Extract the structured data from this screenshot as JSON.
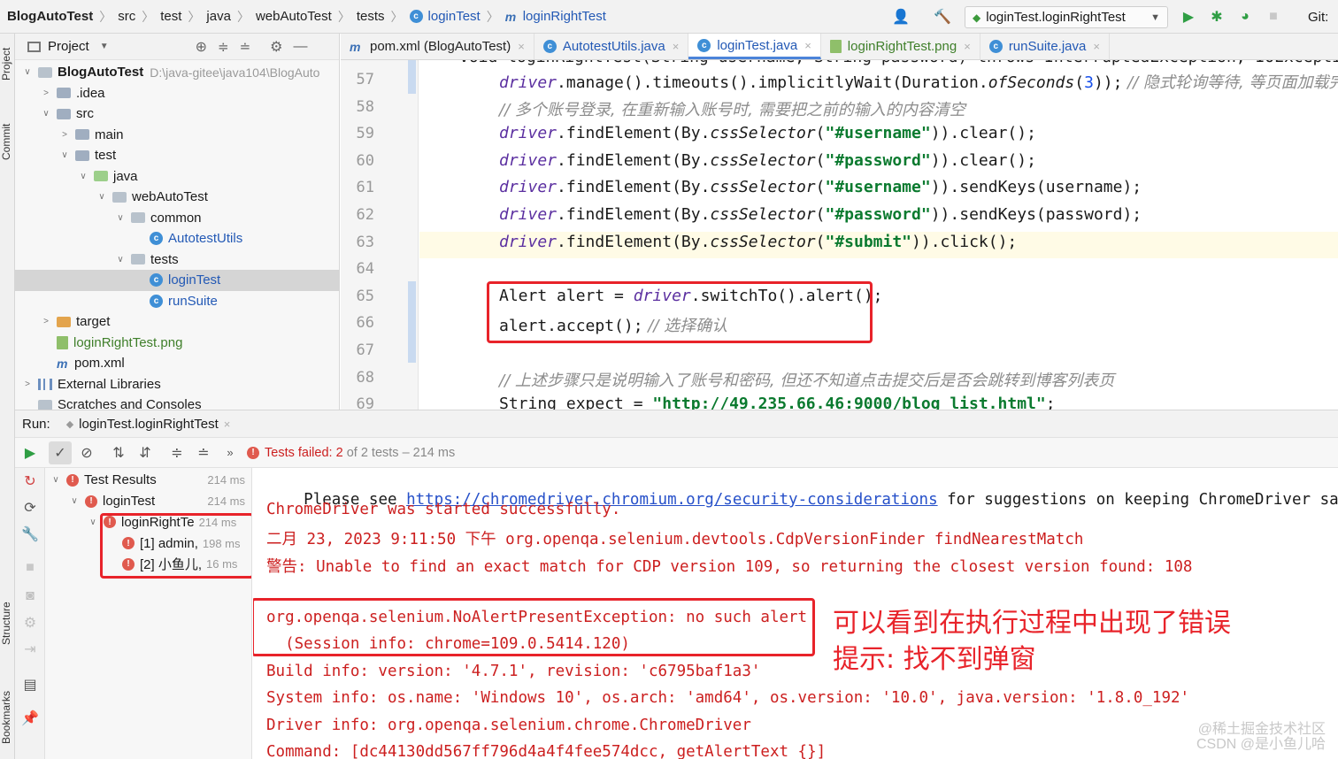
{
  "breadcrumbs": [
    "BlogAutoTest",
    "src",
    "test",
    "java",
    "webAutoTest",
    "tests",
    "loginTest",
    "loginRightTest"
  ],
  "run_config": "loginTest.loginRightTest",
  "vcs_label": "Git:",
  "left_strip": {
    "project": "Project",
    "commit": "Commit",
    "structure": "Structure",
    "bookmarks": "Bookmarks"
  },
  "project_panel": {
    "title": "Project",
    "tree": [
      {
        "label": "BlogAutoTest",
        "path": "D:\\java-gitee\\java104\\BlogAuto",
        "indent": 0,
        "expanded": true,
        "type": "root"
      },
      {
        "label": ".idea",
        "indent": 1,
        "expanded": false,
        "type": "folder"
      },
      {
        "label": "src",
        "indent": 1,
        "expanded": true,
        "type": "folder"
      },
      {
        "label": "main",
        "indent": 2,
        "expanded": false,
        "type": "folder"
      },
      {
        "label": "test",
        "indent": 2,
        "expanded": true,
        "type": "folder"
      },
      {
        "label": "java",
        "indent": 3,
        "expanded": true,
        "type": "test"
      },
      {
        "label": "webAutoTest",
        "indent": 4,
        "expanded": true,
        "type": "pkg"
      },
      {
        "label": "common",
        "indent": 5,
        "expanded": true,
        "type": "pkg"
      },
      {
        "label": "AutotestUtils",
        "indent": 6,
        "type": "class"
      },
      {
        "label": "tests",
        "indent": 5,
        "expanded": true,
        "type": "pkg"
      },
      {
        "label": "loginTest",
        "indent": 6,
        "type": "class",
        "selected": true
      },
      {
        "label": "runSuite",
        "indent": 6,
        "type": "class"
      },
      {
        "label": "target",
        "indent": 1,
        "expanded": false,
        "type": "target"
      },
      {
        "label": "loginRightTest.png",
        "indent": 1,
        "type": "png"
      },
      {
        "label": "pom.xml",
        "indent": 1,
        "type": "maven"
      },
      {
        "label": "External Libraries",
        "indent": 0,
        "expanded": false,
        "type": "lib"
      },
      {
        "label": "Scratches and Consoles",
        "indent": 0,
        "type": "scratch"
      }
    ]
  },
  "editor_tabs": [
    {
      "label": "pom.xml (BlogAutoTest)",
      "icon": "maven-icon",
      "active": false
    },
    {
      "label": "AutotestUtils.java",
      "icon": "class-icon",
      "active": false
    },
    {
      "label": "loginTest.java",
      "icon": "class-icon",
      "active": true
    },
    {
      "label": "loginRightTest.png",
      "icon": "image-icon",
      "active": false
    },
    {
      "label": "runSuite.java",
      "icon": "class-icon",
      "active": false
    }
  ],
  "code_lines": [
    {
      "n": "57",
      "segs": [
        [
          "drv",
          "driver"
        ],
        [
          "",
          ".manage().timeouts().implicitlyWait(Duration."
        ],
        [
          "st",
          "ofSeconds"
        ],
        [
          "",
          "("
        ],
        [
          "num",
          "3"
        ],
        [
          "",
          "));"
        ],
        [
          "cmt",
          " // 隐式轮询等待, 等页面加载完成"
        ]
      ]
    },
    {
      "n": "58",
      "segs": [
        [
          "cmt",
          "// 多个账号登录, 在重新输入账号时, 需要把之前的输入的内容清空"
        ]
      ]
    },
    {
      "n": "59",
      "segs": [
        [
          "drv",
          "driver"
        ],
        [
          "",
          ".findElement(By."
        ],
        [
          "st",
          "cssSelector"
        ],
        [
          "",
          "("
        ],
        [
          "str",
          "\"#username\""
        ],
        [
          "",
          "))"
        ],
        [
          "",
          ".clear();"
        ]
      ]
    },
    {
      "n": "60",
      "segs": [
        [
          "drv",
          "driver"
        ],
        [
          "",
          ".findElement(By."
        ],
        [
          "st",
          "cssSelector"
        ],
        [
          "",
          "("
        ],
        [
          "str",
          "\"#password\""
        ],
        [
          "",
          "))"
        ],
        [
          "",
          ".clear();"
        ]
      ]
    },
    {
      "n": "61",
      "segs": [
        [
          "drv",
          "driver"
        ],
        [
          "",
          ".findElement(By."
        ],
        [
          "st",
          "cssSelector"
        ],
        [
          "",
          "("
        ],
        [
          "str",
          "\"#username\""
        ],
        [
          "",
          "))"
        ],
        [
          "",
          ".sendKeys(username);"
        ]
      ]
    },
    {
      "n": "62",
      "segs": [
        [
          "drv",
          "driver"
        ],
        [
          "",
          ".findElement(By."
        ],
        [
          "st",
          "cssSelector"
        ],
        [
          "",
          "("
        ],
        [
          "str",
          "\"#password\""
        ],
        [
          "",
          "))"
        ],
        [
          "",
          ".sendKeys(password);"
        ]
      ]
    },
    {
      "n": "63",
      "segs": [
        [
          "drv",
          "driver"
        ],
        [
          "",
          ".findElement(By."
        ],
        [
          "st",
          "cssSelector"
        ],
        [
          "",
          "("
        ],
        [
          "str",
          "\"#submit\""
        ],
        [
          "",
          "))"
        ],
        [
          "",
          ".click();"
        ]
      ]
    },
    {
      "n": "64",
      "segs": []
    },
    {
      "n": "65",
      "segs": [
        [
          "",
          "Alert alert = "
        ],
        [
          "drv",
          "driver"
        ],
        [
          "",
          ".switchTo().alert();"
        ]
      ]
    },
    {
      "n": "66",
      "segs": [
        [
          "",
          "alert.accept();"
        ],
        [
          "cmt",
          " // 选择确认"
        ]
      ]
    },
    {
      "n": "67",
      "segs": []
    },
    {
      "n": "68",
      "segs": [
        [
          "cmt",
          "// 上述步骤只是说明输入了账号和密码, 但还不知道点击提交后是否会跳转到博客列表页"
        ]
      ]
    },
    {
      "n": "69",
      "segs": [
        [
          "",
          "String expect = "
        ],
        [
          "str",
          "\"http://49.235.66.46:9000/blog_list.html\""
        ],
        [
          "",
          ";"
        ]
      ]
    }
  ],
  "run_panel": {
    "label": "Run:",
    "config_tab": "loginTest.loginRightTest",
    "status_failed": "Tests failed: 2",
    "status_rest": " of 2 tests – 214 ms",
    "results": [
      {
        "label": "Test Results",
        "dur": "214 ms",
        "indent": 0
      },
      {
        "label": "loginTest",
        "dur": "214 ms",
        "indent": 1
      },
      {
        "label": "loginRightTe",
        "dur": "214 ms",
        "indent": 2
      },
      {
        "label": "[1] admin,",
        "dur": "198 ms",
        "indent": 3
      },
      {
        "label": "[2] 小鱼儿,",
        "dur": "16 ms",
        "indent": 3
      }
    ]
  },
  "console": {
    "line1_pre": "Please see ",
    "line1_link": "https://chromedriver.chromium.org/security-considerations",
    "line1_post": " for suggestions on keeping ChromeDriver safe.",
    "line2": "ChromeDriver was started successfully.",
    "line3": "二月 23, 2023 9:11:50 下午 org.openqa.selenium.devtools.CdpVersionFinder findNearestMatch",
    "line4": "警告: Unable to find an exact match for CDP version 109, so returning the closest version found: 108",
    "line5": "org.openqa.selenium.NoAlertPresentException: no such alert",
    "line6": "  (Session info: chrome=109.0.5414.120)",
    "line7": "Build info: version: '4.7.1', revision: 'c6795baf1a3'",
    "line8": "System info: os.name: 'Windows 10', os.arch: 'amd64', os.version: '10.0', java.version: '1.8.0_192'",
    "line9": "Driver info: org.openqa.selenium.chrome.ChromeDriver",
    "line10": "Command: [dc44130dd567ff796d4a4f4fee574dcc, getAlertText {}]"
  },
  "annotation": {
    "line1": "可以看到在执行过程中出现了错误",
    "line2": "提示: 找不到弹窗"
  },
  "watermark": {
    "line1": "@稀土掘金技术社区",
    "line2": "CSDN @是小鱼儿哈"
  },
  "colors": {
    "accent": "#4c84d9",
    "highlight_red": "#e8232a",
    "error_red": "#cc1f1f",
    "run_green": "#2f9e44"
  }
}
